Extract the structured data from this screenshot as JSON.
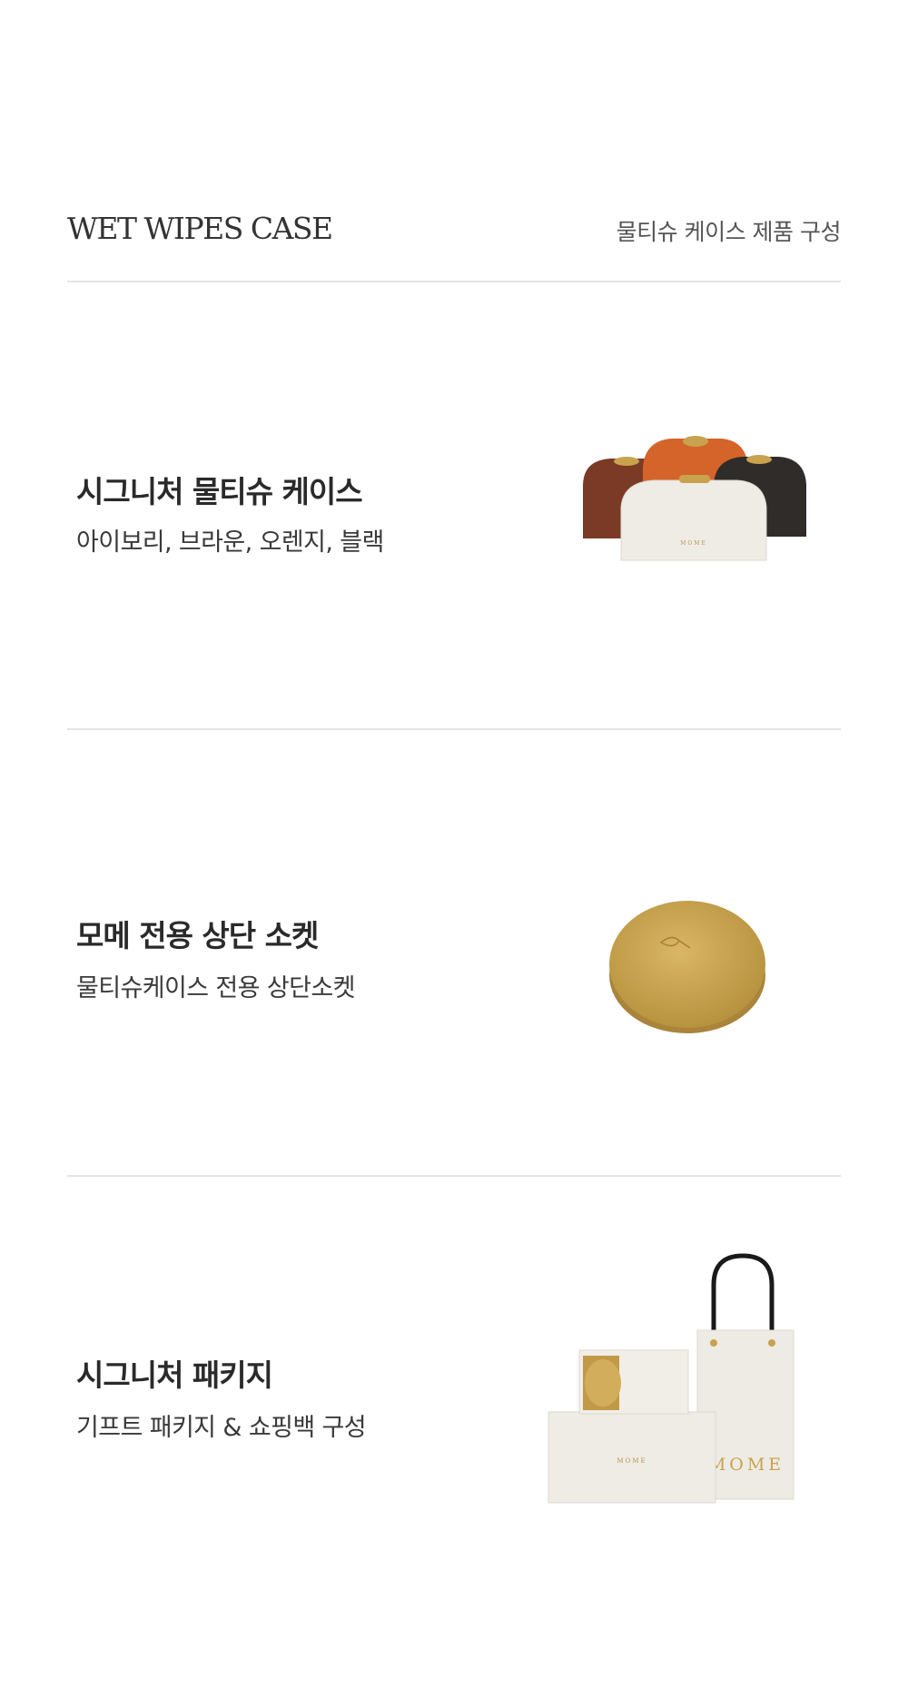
{
  "header": {
    "title": "WET WIPES CASE",
    "subtitle": "물티슈 케이스 제품 구성"
  },
  "sections": [
    {
      "title": "시그니처 물티슈 케이스",
      "description": "아이보리, 브라운, 오렌지, 블랙",
      "image": "wet-wipes-cases-four-colors",
      "case_label": "MOME"
    },
    {
      "title": "모메 전용 상단 소켓",
      "description": "물티슈케이스 전용 상단소켓",
      "image": "gold-socket-lid"
    },
    {
      "title": "시그니처 패키지",
      "description": "기프트 패키지 & 쇼핑백 구성",
      "image": "gift-package-and-shopping-bag",
      "box_label": "MOME",
      "bag_label": "MOME"
    }
  ],
  "colors": {
    "ivory": "#efece6",
    "brown": "#7a3a25",
    "orange": "#d4642a",
    "black": "#2f2c29",
    "gold": "#c9a24e",
    "divider": "#e4e4e4"
  }
}
